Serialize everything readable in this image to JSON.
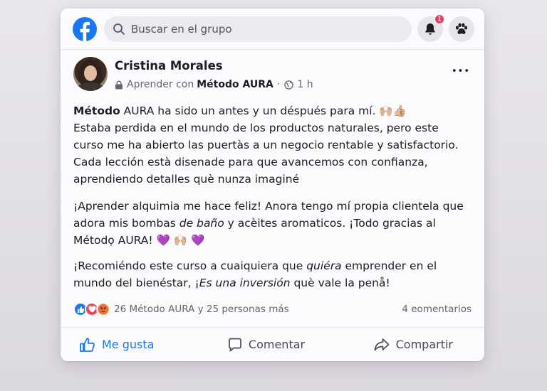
{
  "search": {
    "placeholder": "Buscar en el grupo"
  },
  "notifications": {
    "badge_count": "1"
  },
  "post": {
    "author": "Cristina Morales",
    "subline_prefix": "Aprender con",
    "group": "Método AURA",
    "dot": "·",
    "time": "1 h",
    "more_label": "•••",
    "para1_bold": "Método",
    "para1_line1": " AURA ha sido un antes y un déspués para mí. 🙌🏼👍🏼",
    "para1_rest": "Estaba perdida en el mundo de los productos naturales, pero este curso me ha abierto las puertàs a un negocio rentable y satisfactorio. Cada lección està disenade para que avancemos con confianza, aprendiendo detalles què nunza imaginé",
    "para2_a": "¡Aprender alquimia me hace feliz! Anora tengo mí propia clientela que adora mis bombas ",
    "para2_italic": "de baño",
    "para2_b": " y acèites aromaticos. ¡Todo gracias al Métodọ AURA! 💜 🙌🏼 💜",
    "para3_a": "¡Recomiéndo este curso a cuaiquiera que ",
    "para3_italic1": "quiéra",
    "para3_b": " emprender en el mundo del bienéstar, ¡",
    "para3_italic2": "Es una inversión",
    "para3_c": " què vale la penå!"
  },
  "reactions": {
    "summary": "26 Método AURA y 25 personas más",
    "comments": "4 eomentarios",
    "icons": [
      "like-icon",
      "love-icon",
      "angry-icon"
    ]
  },
  "actions": {
    "like": "Me gusta",
    "comment": "Comentar",
    "share": "Compartir"
  },
  "colors": {
    "brand": "#1877f2",
    "love": "#f33e58",
    "angry": "#f7b125",
    "badge": "#e4405f"
  }
}
